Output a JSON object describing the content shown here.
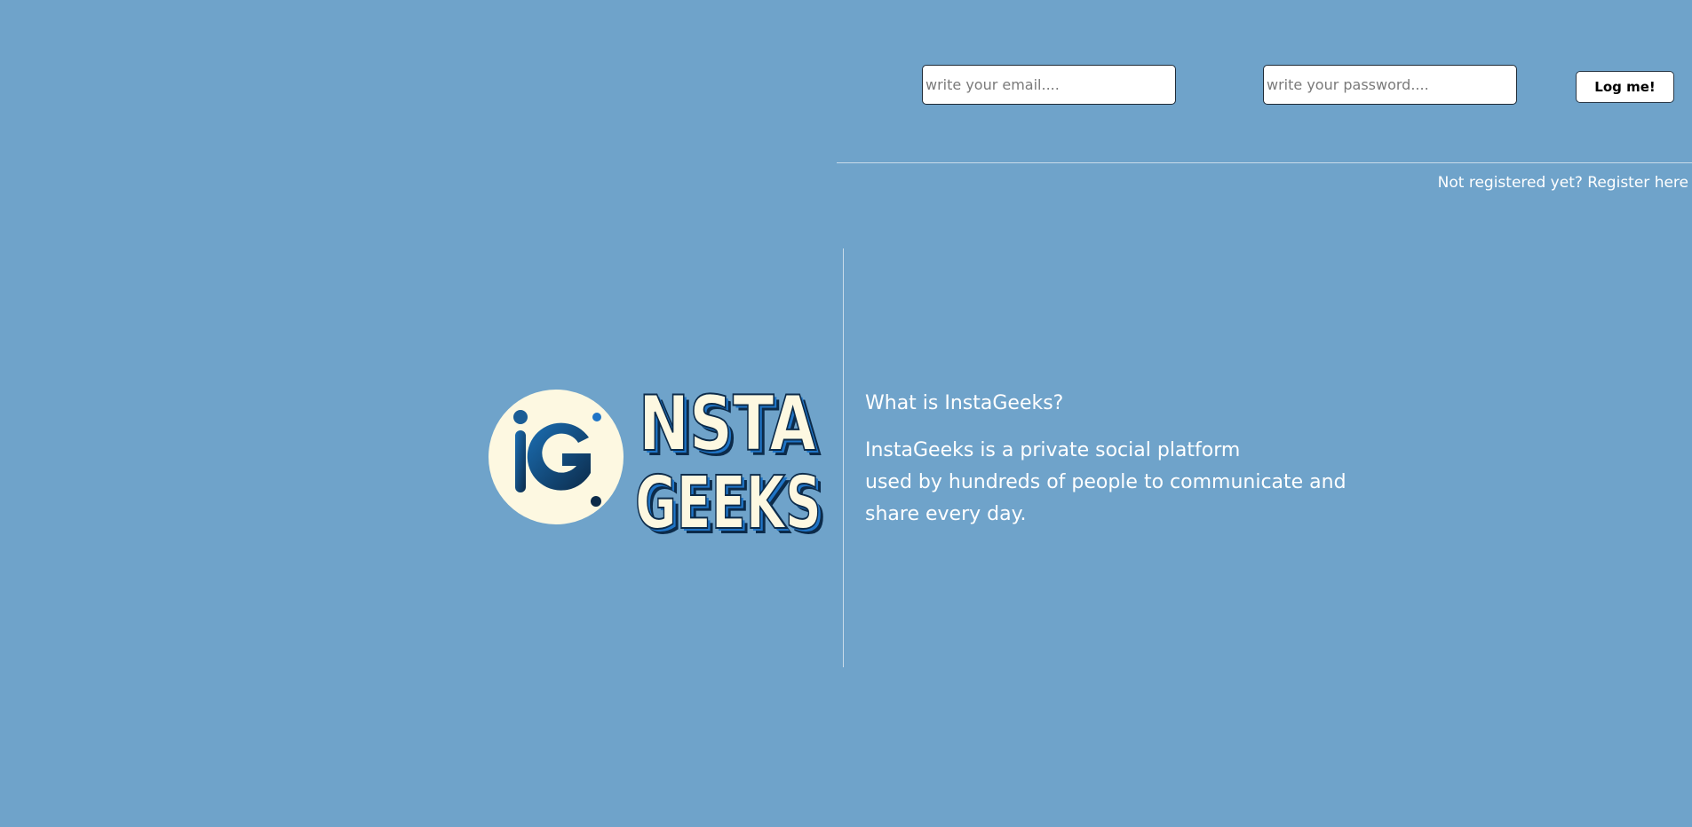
{
  "header": {
    "email_placeholder": "write your email....",
    "password_placeholder": "write your password....",
    "login_label": "Log me!",
    "register_text": "Not registered yet? Register here"
  },
  "brand": {
    "logo_monogram": "iG",
    "logo_line1": "NSTA",
    "logo_line2": "GEEKS",
    "colors": {
      "background": "#6fa3ca",
      "logo_cream": "#fdf8e1",
      "logo_blue": "#1f74c6",
      "logo_dark": "#0c2b4a"
    }
  },
  "about": {
    "title": "What is InstaGeeks?",
    "lines": [
      "InstaGeeks is a private social platform",
      "used by hundreds of people to communicate and",
      "share every day."
    ]
  }
}
